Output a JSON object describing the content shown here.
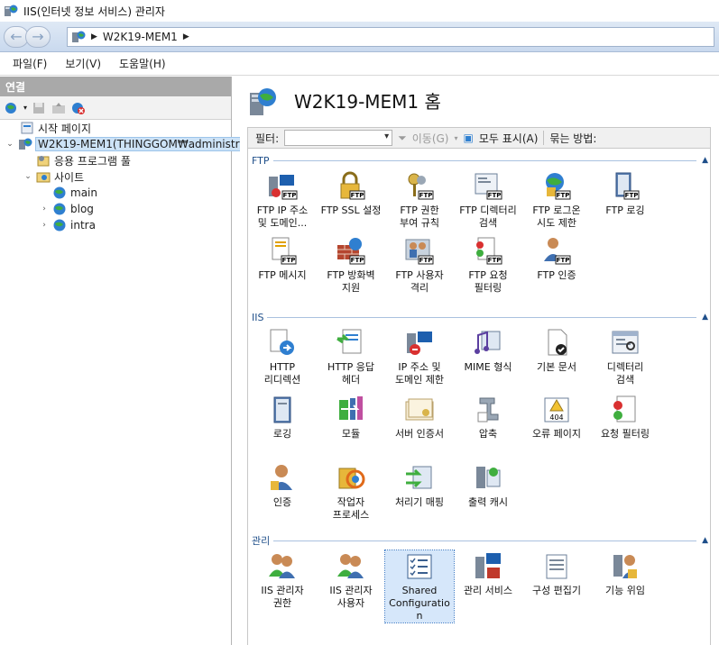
{
  "window": {
    "title": "IIS(인터넷 정보 서비스) 관리자"
  },
  "address": {
    "crumb": "W2K19-MEM1"
  },
  "menu": {
    "items": [
      "파일(F)",
      "보기(V)",
      "도움말(H)"
    ]
  },
  "connections": {
    "header": "연결",
    "tree": [
      {
        "label": "시작 페이지"
      },
      {
        "label": "W2K19-MEM1(THINGGOM₩administra"
      },
      {
        "label": "응용 프로그램 풀"
      },
      {
        "label": "사이트"
      },
      {
        "label": "main"
      },
      {
        "label": "blog"
      },
      {
        "label": "intra"
      }
    ]
  },
  "content": {
    "title": "W2K19-MEM1 홈",
    "filter": {
      "label": "필터:",
      "go": "이동(G)",
      "show_all": "모두 표시(A)",
      "group_by": "묶는 방법:"
    },
    "groups": [
      {
        "name": "FTP",
        "features": [
          {
            "label": "FTP IP 주소\n및 도메인..."
          },
          {
            "label": "FTP SSL 설정"
          },
          {
            "label": "FTP 권한\n부여 규칙"
          },
          {
            "label": "FTP 디렉터리\n검색"
          },
          {
            "label": "FTP 로그온\n시도 제한"
          },
          {
            "label": "FTP 로깅"
          },
          {
            "label": "FTP 메시지"
          },
          {
            "label": "FTP 방화벽\n지원"
          },
          {
            "label": "FTP 사용자\n격리"
          },
          {
            "label": "FTP 요청\n필터링"
          },
          {
            "label": "FTP 인증"
          }
        ]
      },
      {
        "name": "IIS",
        "features": [
          {
            "label": "HTTP\n리디렉션"
          },
          {
            "label": "HTTP 응답\n헤더"
          },
          {
            "label": "IP 주소 및\n도메인 제한"
          },
          {
            "label": "MIME 형식"
          },
          {
            "label": "기본 문서"
          },
          {
            "label": "디렉터리\n검색"
          },
          {
            "label": "로깅"
          },
          {
            "label": "모듈"
          },
          {
            "label": "서버 인증서"
          },
          {
            "label": "압축"
          },
          {
            "label": "오류 페이지"
          },
          {
            "label": "요청 필터링"
          },
          {
            "label": "인증"
          },
          {
            "label": "작업자\n프로세스"
          },
          {
            "label": "처리기 매핑"
          },
          {
            "label": "출력 캐시"
          }
        ]
      },
      {
        "name": "관리",
        "features": [
          {
            "label": "IIS 관리자\n권한"
          },
          {
            "label": "IIS 관리자\n사용자"
          },
          {
            "label": "Shared\nConfiguratio\nn"
          },
          {
            "label": "관리 서비스"
          },
          {
            "label": "구성 편집기"
          },
          {
            "label": "기능 위임"
          }
        ]
      }
    ]
  },
  "colors": {
    "accent": "#1f4f8a",
    "selection": "#d6e7fa",
    "pane_header": "#a9a9a9"
  }
}
